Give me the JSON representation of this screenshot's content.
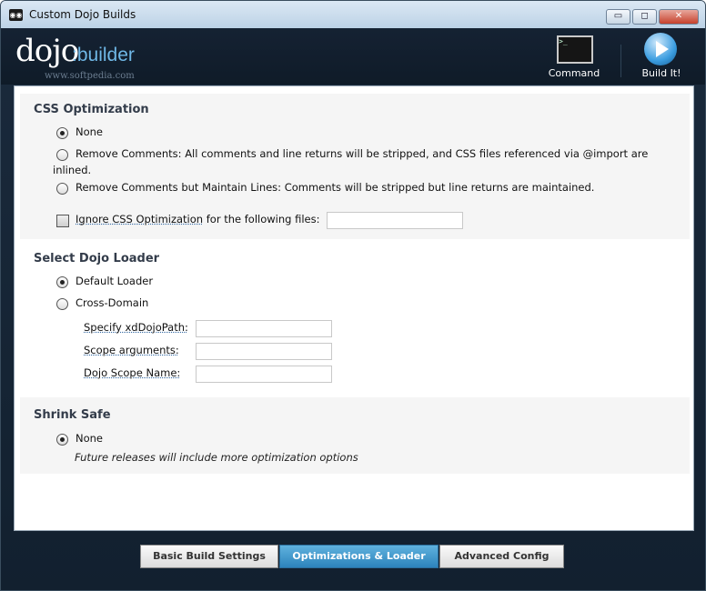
{
  "window": {
    "title": "Custom Dojo Builds",
    "icon": "dojo-app-icon"
  },
  "window_controls": {
    "minimize": "▭",
    "maximize": "◻",
    "close": "✕"
  },
  "header": {
    "logo_dojo": "dojo",
    "logo_builder": ":builder",
    "watermark": "www.softpedia.com",
    "command_label": "Command",
    "command_glyph": ">_",
    "build_label": "Build It!",
    "icons": [
      "terminal-icon",
      "play-icon"
    ]
  },
  "css_optimization": {
    "title": "CSS Optimization",
    "options": [
      {
        "label": "None",
        "checked": true
      },
      {
        "label": "Remove Comments: All comments and line returns will be stripped, and CSS files referenced via @import are",
        "label_cont": "inlined.",
        "checked": false
      },
      {
        "label": "Remove Comments but Maintain Lines: Comments will be stripped but line returns are maintained.",
        "checked": false
      }
    ],
    "ignore_link": "Ignore CSS Optimization",
    "ignore_suffix": " for the following files:",
    "ignore_value": ""
  },
  "dojo_loader": {
    "title": "Select Dojo Loader",
    "options": [
      {
        "label": "Default Loader",
        "checked": true
      },
      {
        "label": "Cross-Domain",
        "checked": false
      }
    ],
    "fields": [
      {
        "label": "Specify xdDojoPath:",
        "value": ""
      },
      {
        "label": "Scope arguments:",
        "value": ""
      },
      {
        "label": "Dojo Scope Name:",
        "value": ""
      }
    ]
  },
  "shrink_safe": {
    "title": "Shrink Safe",
    "option": "None",
    "note": "Future releases will include more optimization options"
  },
  "tabs": [
    {
      "label": "Basic Build Settings",
      "active": false
    },
    {
      "label": "Optimizations & Loader",
      "active": true
    },
    {
      "label": "Advanced Config",
      "active": false
    }
  ],
  "colors": {
    "accent": "#3b91cf",
    "header_bg": "#152233",
    "panel_bg": "#f5f5f5"
  }
}
